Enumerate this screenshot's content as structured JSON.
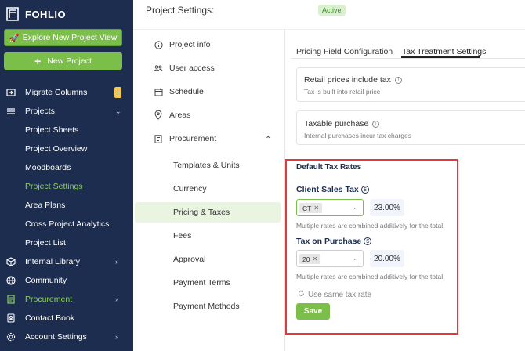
{
  "brand": {
    "logo_text": "FOHLIO"
  },
  "sidebar": {
    "explore_label": "Explore New Project View",
    "new_project_label": "New Project",
    "items": [
      {
        "label": "Migrate Columns",
        "badge": "!"
      },
      {
        "label": "Projects"
      },
      {
        "label": "Project Sheets"
      },
      {
        "label": "Project Overview"
      },
      {
        "label": "Moodboards"
      },
      {
        "label": "Project Settings"
      },
      {
        "label": "Area Plans"
      },
      {
        "label": "Cross Project Analytics"
      },
      {
        "label": "Project List"
      },
      {
        "label": "Internal Library"
      },
      {
        "label": "Community"
      },
      {
        "label": "Procurement"
      },
      {
        "label": "Contact Book"
      },
      {
        "label": "Account Settings"
      }
    ]
  },
  "header": {
    "title": "Project Settings:",
    "status": "Active"
  },
  "settings_menu": {
    "items": [
      "Project info",
      "User access",
      "Schedule",
      "Areas",
      "Procurement"
    ],
    "procurement_children": [
      "Templates & Units",
      "Currency",
      "Pricing & Taxes",
      "Fees",
      "Approval",
      "Payment Terms",
      "Payment Methods"
    ]
  },
  "tabs": [
    "Pricing Field Configuration",
    "Tax Treatment Settings"
  ],
  "options": [
    {
      "title": "Retail prices include tax",
      "subtitle": "Tax is built into retail price"
    },
    {
      "title": "Taxable purchase",
      "subtitle": "Internal purchases incur tax charges"
    }
  ],
  "tax_rates": {
    "title": "Default Tax Rates",
    "client_label": "Client Sales Tax",
    "client_chip": "CT",
    "client_rate": "23.00%",
    "client_hint": "Multiple rates are combined additively for the total.",
    "purchase_label": "Tax on Purchase",
    "purchase_chip": "20",
    "purchase_rate": "20.00%",
    "purchase_hint": "Multiple rates are combined additively for the total.",
    "same_rate_label": "Use same tax rate",
    "save_label": "Save"
  },
  "colors": {
    "sidebar_bg": "#1d2d50",
    "accent_green": "#7bbf4a",
    "highlight_red": "#e0393e"
  }
}
